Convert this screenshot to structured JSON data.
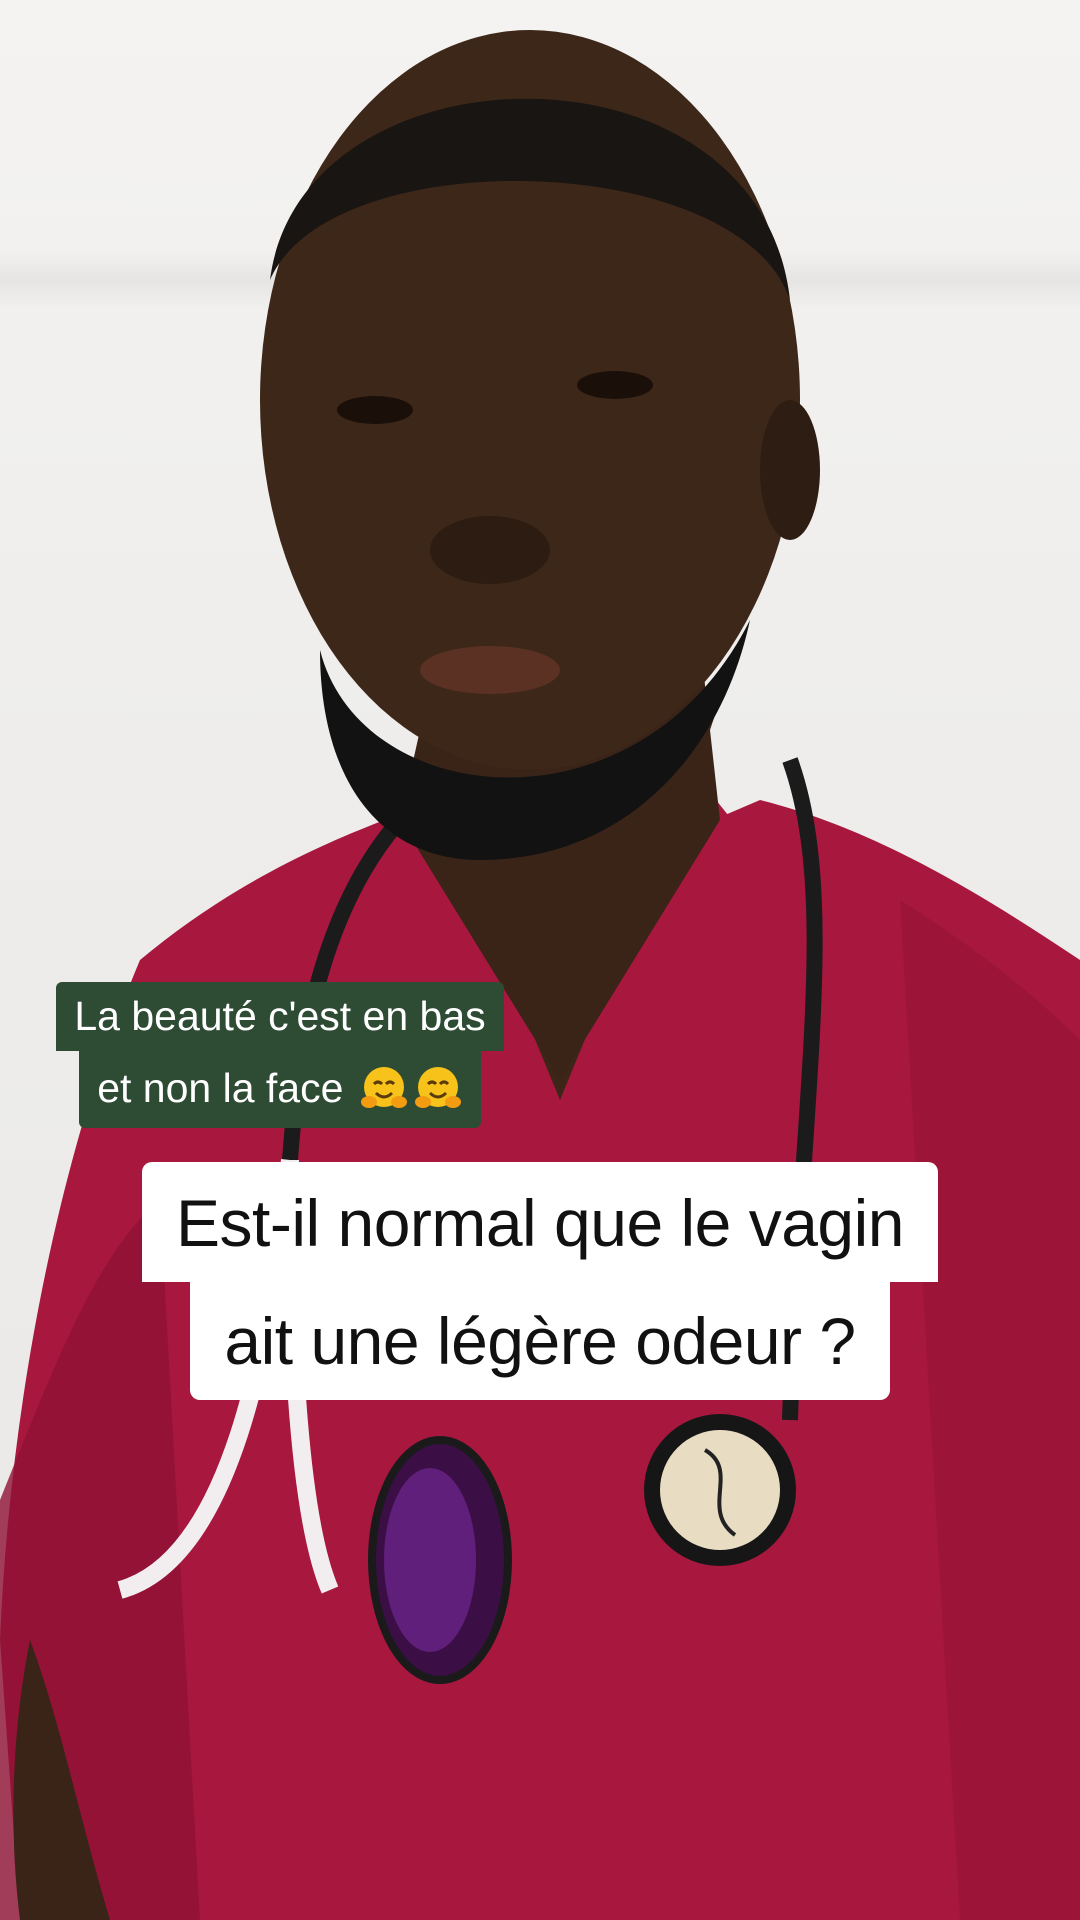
{
  "video": {
    "scene_description_icon": "doctor-video-frame"
  },
  "captions": {
    "top_line1": "La beauté c'est en bas",
    "top_line2": "et non la face",
    "top_emoji": "hugging-face-emoji",
    "main_line1": "Est-il normal que le vagin",
    "main_line2": "ait une légère odeur ?"
  },
  "colors": {
    "caption_green": "#2e4b34",
    "caption_white": "#ffffff",
    "scrubs": "#a8173e"
  }
}
